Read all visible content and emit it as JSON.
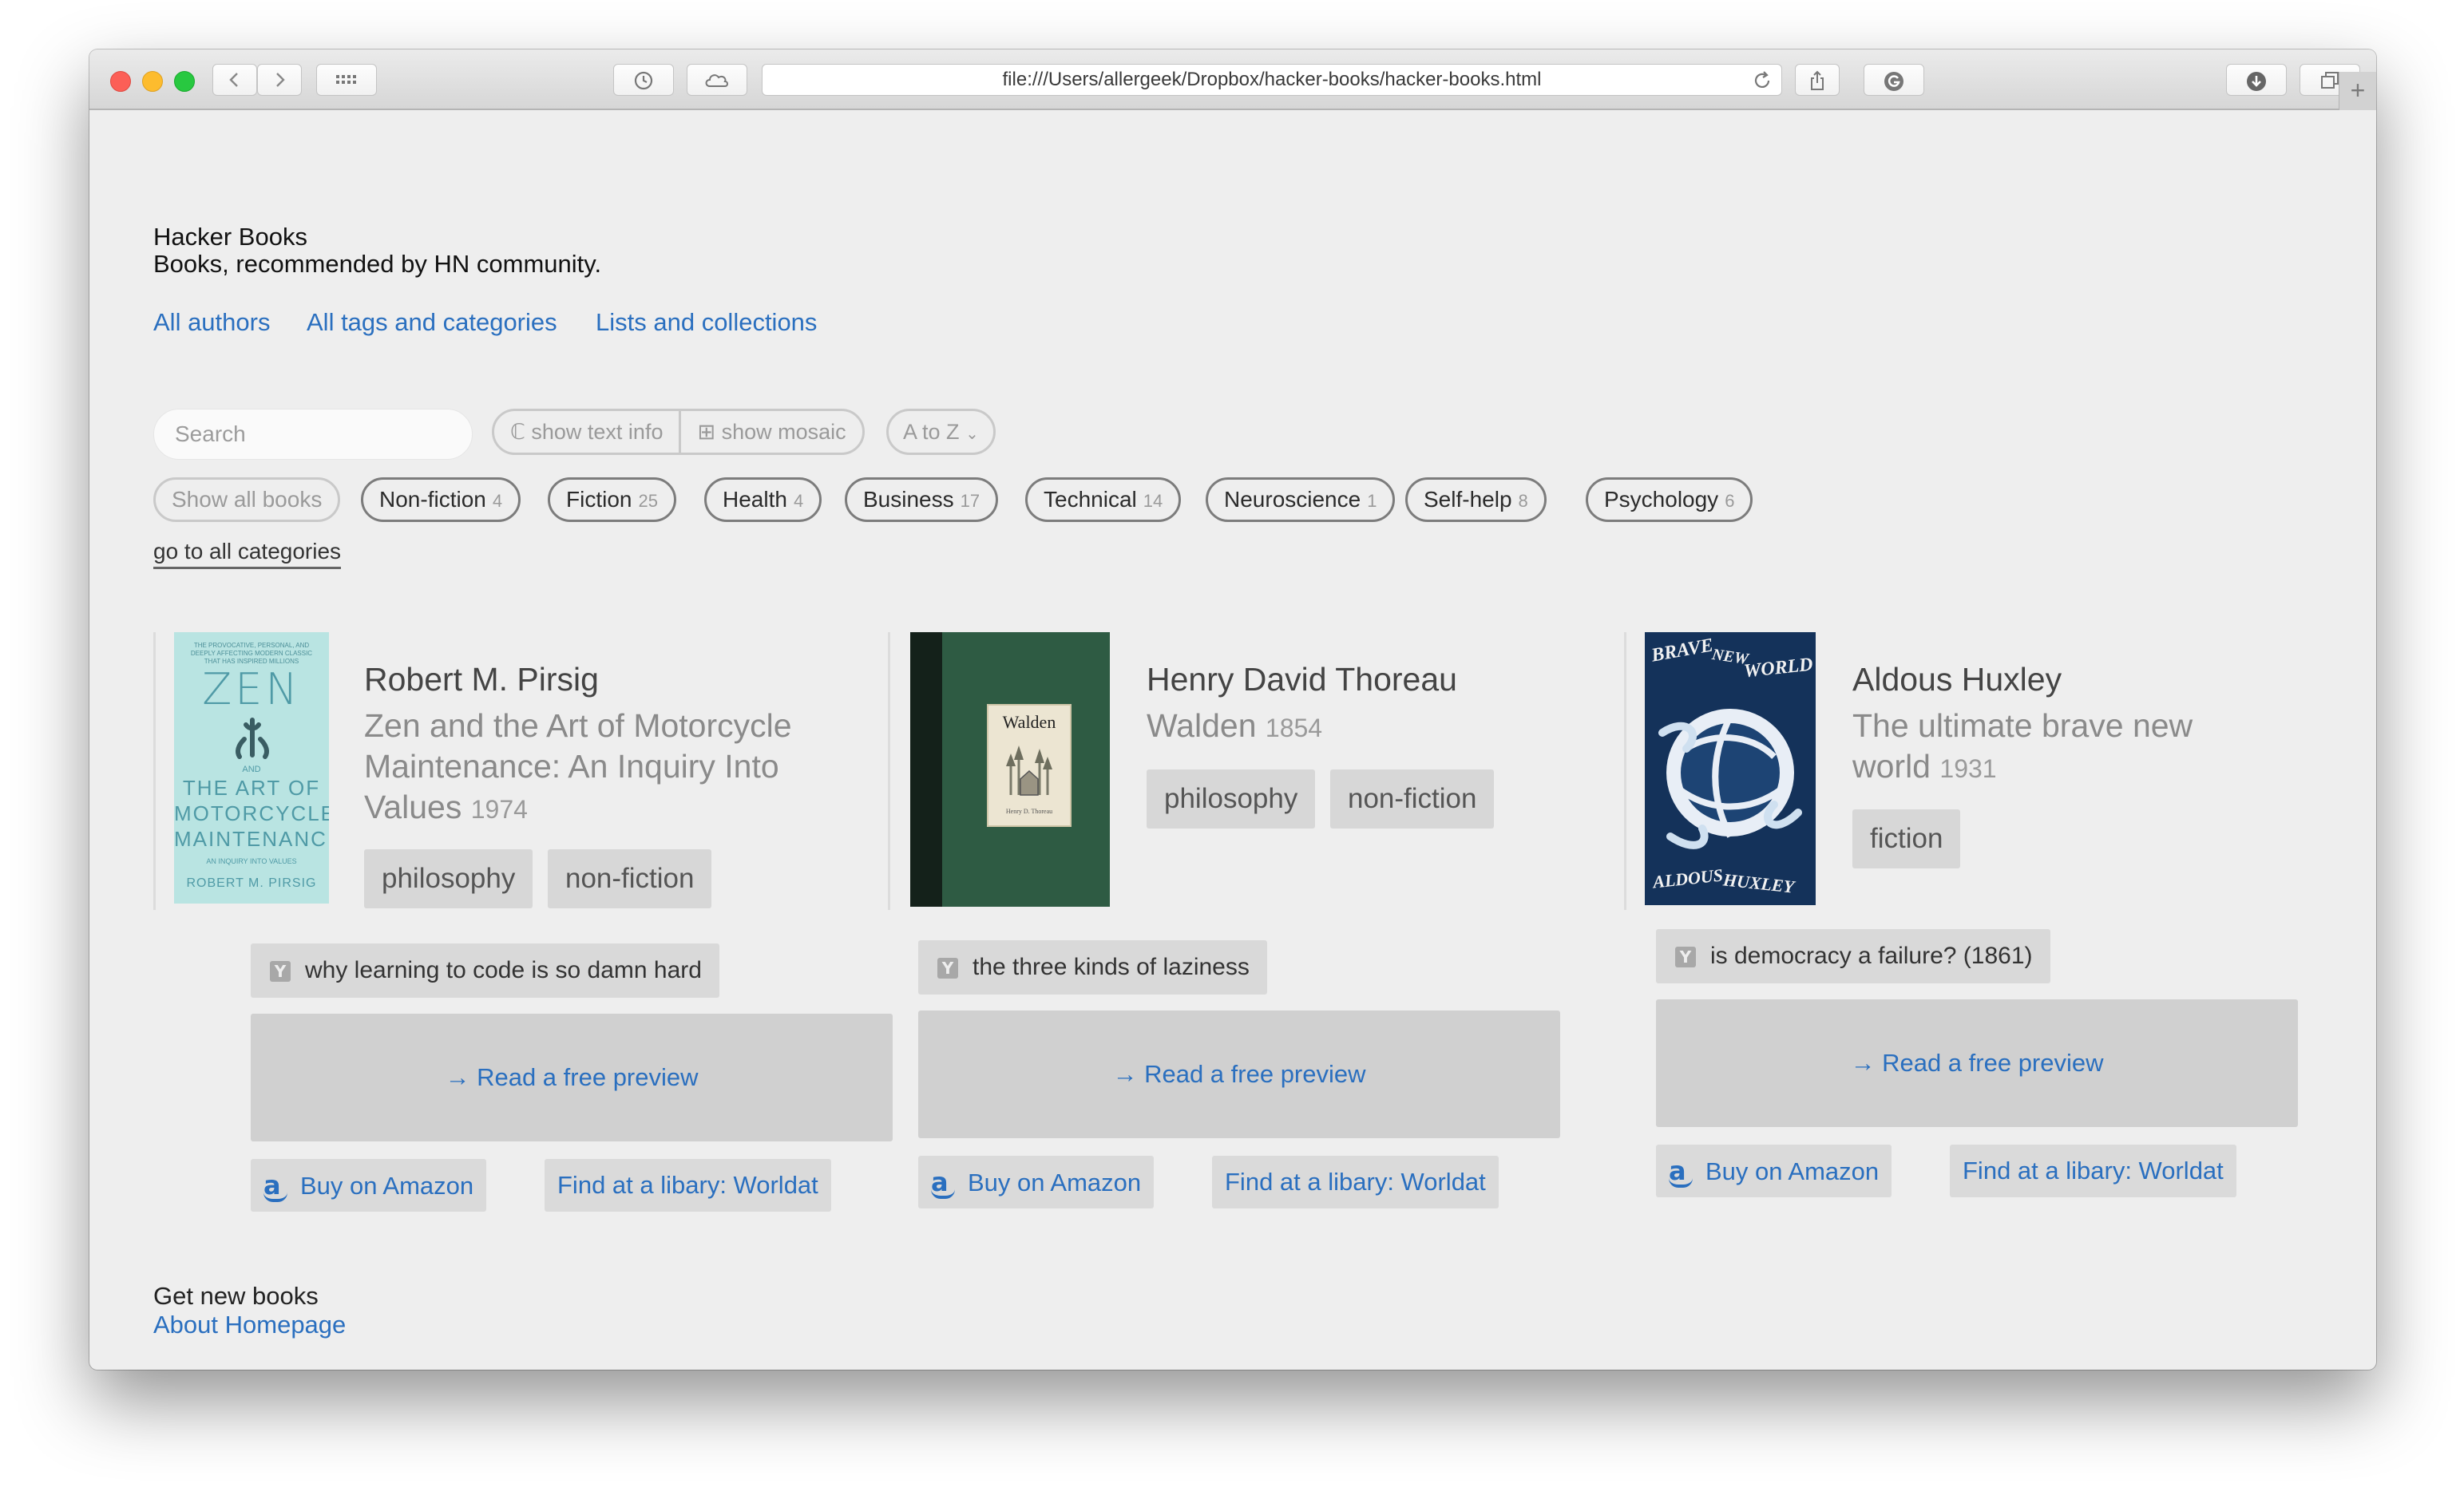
{
  "browser": {
    "url": "file:///Users/allergeek/Dropbox/hacker-books/hacker-books.html"
  },
  "site": {
    "title": "Hacker Books",
    "subtitle": "Books, recommended by HN community."
  },
  "nav": {
    "authors": "All authors",
    "tags": "All tags and categories",
    "lists": "Lists and collections"
  },
  "controls": {
    "search_placeholder": "Search",
    "text_info": "show text info",
    "mosaic": "show mosaic",
    "sort": "A to Z"
  },
  "categories": [
    {
      "label": "Show all books",
      "count": ""
    },
    {
      "label": "Non-fiction",
      "count": "4"
    },
    {
      "label": "Fiction",
      "count": "25"
    },
    {
      "label": "Health",
      "count": "4"
    },
    {
      "label": "Business",
      "count": "17"
    },
    {
      "label": "Technical",
      "count": "14"
    },
    {
      "label": "Neuroscience",
      "count": "1"
    },
    {
      "label": "Self-help",
      "count": "8"
    },
    {
      "label": "Psychology",
      "count": "6"
    }
  ],
  "all_categories_link": "go to all categories",
  "books": [
    {
      "author": "Robert M. Pirsig",
      "title": "Zen and the Art of Motorcycle Maintenance: An Inquiry Into Values",
      "year": "1974",
      "tags": [
        "philosophy",
        "non-fiction"
      ],
      "hn_link": "why learning to code is so damn hard",
      "preview": "→ Read a free preview",
      "amazon": "Buy on Amazon",
      "worldcat": "Find at a libary: Worldat",
      "cover": {
        "top_text": "THE PROVOCATIVE, PERSONAL, AND DEEPLY AFFECTING MODERN CLASSIC THAT HAS INSPIRED MILLIONS",
        "zen": "ZEN",
        "and": "AND",
        "line1": "THE ART OF",
        "line2": "MOTORCYCLE",
        "line3": "MAINTENANCE",
        "sub": "AN INQUIRY INTO VALUES",
        "author": "ROBERT M. PIRSIG"
      }
    },
    {
      "author": "Henry David Thoreau",
      "title": "Walden",
      "year": "1854",
      "tags": [
        "philosophy",
        "non-fiction"
      ],
      "hn_link": "the three kinds of laziness",
      "preview": "→ Read a free preview",
      "amazon": "Buy on Amazon",
      "worldcat": "Find at a libary: Worldat",
      "cover": {
        "title": "Walden",
        "sub": "Henry D. Thoreau"
      }
    },
    {
      "author": "Aldous Huxley",
      "title": "The ultimate brave new world",
      "year": "1931",
      "tags": [
        "fiction"
      ],
      "hn_link": "is democracy a failure? (1861)",
      "preview": "→ Read a free preview",
      "amazon": "Buy on Amazon",
      "worldcat": "Find at a libary: Worldat",
      "cover": {
        "brave": "BRAVE",
        "new": "NEW",
        "world": "WORLD",
        "aldous": "ALDOUS",
        "huxley": "HUXLEY"
      }
    }
  ],
  "footer": {
    "text": "Get new books",
    "link": "About Homepage"
  },
  "colors": {
    "link": "#2a6fbf",
    "page_bg": "#eeeeee",
    "zen_cover": "#b9e4e2",
    "walden_cover": "#2e5b43",
    "huxley_cover": "#14325a"
  }
}
